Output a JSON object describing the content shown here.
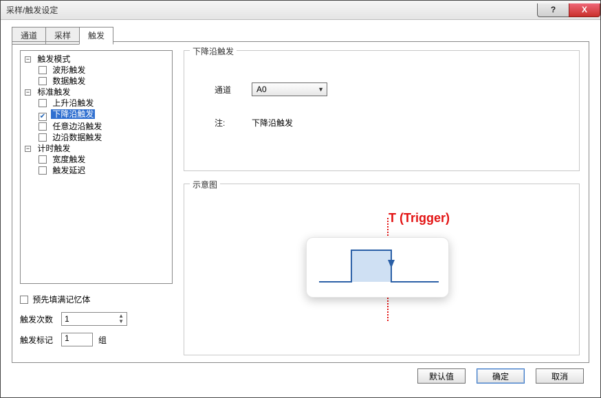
{
  "window": {
    "title": "采样/触发设定"
  },
  "titlebar": {
    "help": "?",
    "close": "X"
  },
  "tabs": [
    "通道",
    "采样",
    "触发"
  ],
  "active_tab_index": 2,
  "tree": {
    "groups": [
      {
        "label": "触发模式",
        "items": [
          {
            "label": "波形触发",
            "checked": false
          },
          {
            "label": "数据触发",
            "checked": false
          }
        ]
      },
      {
        "label": "标准触发",
        "items": [
          {
            "label": "上升沿触发",
            "checked": false
          },
          {
            "label": "下降沿触发",
            "checked": true,
            "selected": true
          },
          {
            "label": "任意边沿触发",
            "checked": false
          },
          {
            "label": "边沿数据触发",
            "checked": false
          }
        ]
      },
      {
        "label": "计时触发",
        "items": [
          {
            "label": "宽度触发",
            "checked": false
          },
          {
            "label": "触发延迟",
            "checked": false
          }
        ]
      }
    ]
  },
  "left_controls": {
    "prefill_label": "预先填满记忆体",
    "prefill_checked": false,
    "count_label": "触发次数",
    "count_value": "1",
    "mark_label": "触发标记",
    "mark_value": "1",
    "mark_unit": "组"
  },
  "group1": {
    "legend": "下降沿触发",
    "channel_label": "通道",
    "channel_value": "A0",
    "note_label": "注:",
    "note_value": "下降沿触发"
  },
  "group2": {
    "legend": "示意图",
    "trigger_text": "T (Trigger)"
  },
  "buttons": {
    "default": "默认值",
    "ok": "确定",
    "cancel": "取消"
  }
}
